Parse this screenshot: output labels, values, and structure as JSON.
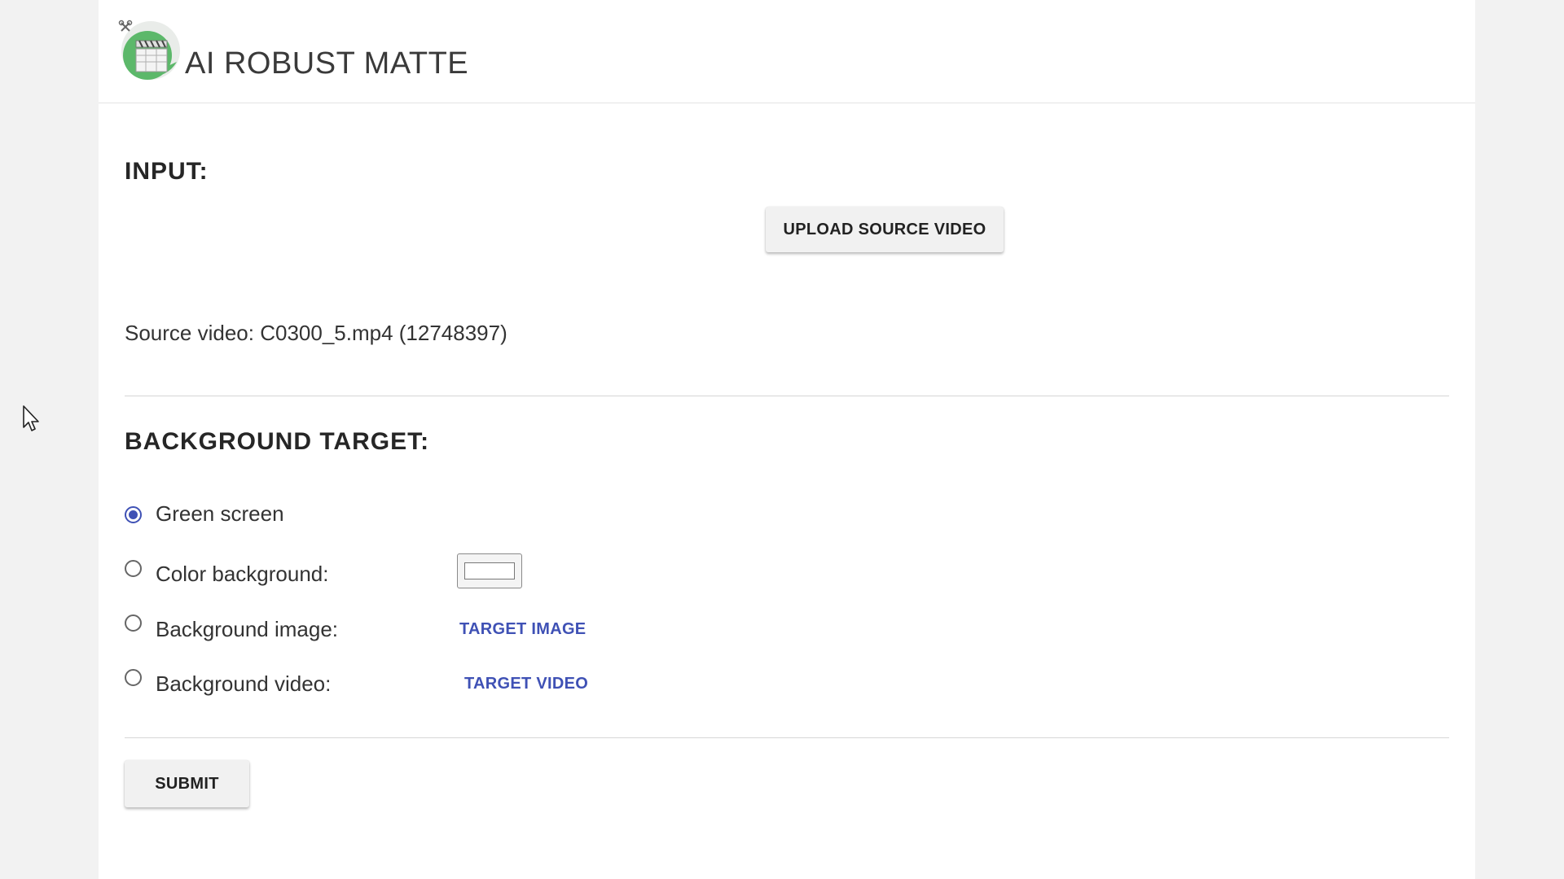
{
  "header": {
    "app_title": "AI ROBUST MATTE"
  },
  "input_section": {
    "title": "INPUT:",
    "upload_button": "UPLOAD SOURCE VIDEO",
    "source_video_text": "Source video: C0300_5.mp4 (12748397)"
  },
  "background_section": {
    "title": "BACKGROUND TARGET:",
    "options": [
      {
        "label": "Green screen",
        "checked": true
      },
      {
        "label": "Color background:",
        "checked": false
      },
      {
        "label": "Background image:",
        "checked": false,
        "action": "TARGET IMAGE"
      },
      {
        "label": "Background video:",
        "checked": false,
        "action": "TARGET VIDEO"
      }
    ],
    "color_value": "#ffffff"
  },
  "submit_button": "SUBMIT",
  "colors": {
    "accent": "#3f51b5",
    "logo_green": "#5cb86a",
    "page_bg": "#f2f2f2",
    "card_bg": "#ffffff"
  },
  "icons": {
    "logo": "clapperboard-scissors-icon",
    "cursor": "mouse-pointer-icon"
  }
}
